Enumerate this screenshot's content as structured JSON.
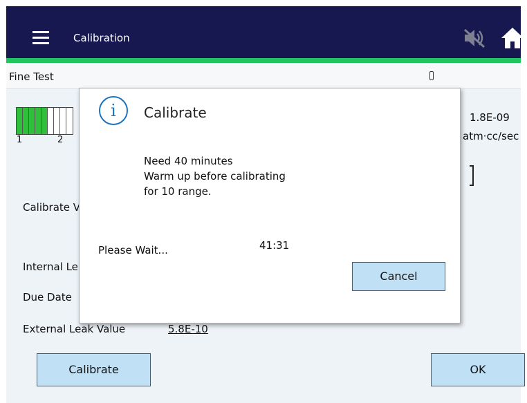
{
  "header": {
    "title": "Calibration",
    "menu_icon": "hamburger-menu-icon",
    "mute_icon": "speaker-muted-icon",
    "home_icon": "home-icon",
    "background": "#16184f",
    "accent": "#21c55d"
  },
  "subbar": {
    "title": "Fine Test"
  },
  "range_indicator": {
    "lit_segments": 5,
    "total_segments_visible": 9,
    "labels": [
      "1",
      "2"
    ],
    "on_color": "#2fbf3a"
  },
  "reading": {
    "value": "1.8E-09",
    "units": "atm·cc/sec"
  },
  "fields": {
    "calibrate_label": "Calibrate V",
    "internal_leak_label": "Internal Le",
    "due_date_label": "Due Date",
    "external_leak_label": "External Leak Value",
    "external_leak_value": "5.8E-10"
  },
  "buttons": {
    "calibrate": "Calibrate",
    "ok": "OK",
    "color": "#bfe0f5"
  },
  "dialog": {
    "icon": "info-icon",
    "icon_glyph": "i",
    "title": "Calibrate",
    "message_lines": [
      "Need 40 minutes",
      "Warm up before calibrating",
      "for 10 range."
    ],
    "wait_text": "Please Wait...",
    "timer": "41:31",
    "cancel_label": "Cancel"
  }
}
